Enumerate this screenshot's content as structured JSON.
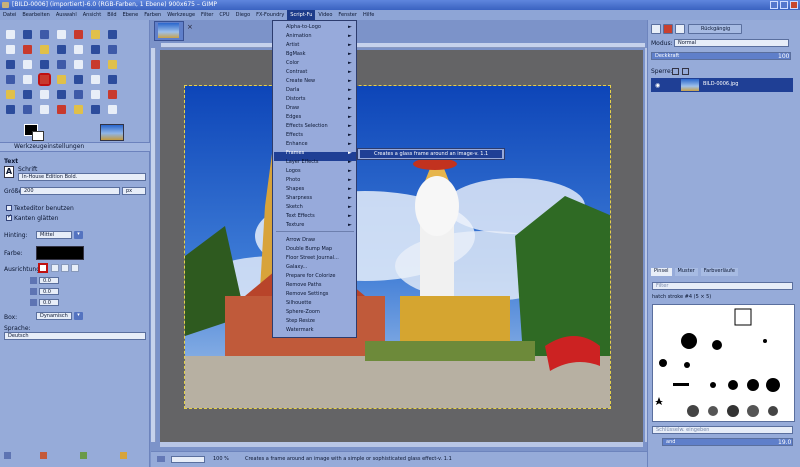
{
  "window": {
    "title": "[BILD-0006] (importiert)-6.0 (RGB-Farben, 1 Ebene) 900x675 – GIMP"
  },
  "menubar": [
    "Datei",
    "Bearbeiten",
    "Auswahl",
    "Ansicht",
    "Bild",
    "Ebene",
    "Farben",
    "Werkzeuge",
    "Filter",
    "CPU",
    "Diego",
    "FX-Foundry",
    "Script-Fu",
    "Video",
    "Fenster",
    "Hilfe"
  ],
  "toolbox": {
    "options_tab": "Werkzeugeinstellungen",
    "tool_name": "Text",
    "font_label": "Schrift",
    "font_value": "In-House Edition Bold.",
    "size_label": "Größe:",
    "size_value": "200",
    "size_unit": "px",
    "use_editor": "Texteditor benutzen",
    "antialias": "Kanten glätten",
    "hinting_label": "Hinting:",
    "hinting_value": "Mittel",
    "color_label": "Farbe:",
    "justify_label": "Ausrichtung",
    "indent_value": "0.0",
    "line_spacing_value": "0.0",
    "letter_spacing_value": "0.0",
    "box_label": "Box:",
    "box_value": "Dynamisch",
    "language_label": "Sprache:",
    "language_value": "Deutsch"
  },
  "scriptfu_menu": {
    "group1": [
      "Alpha-to-Logo",
      "Animation",
      "Artist",
      "BgMask",
      "Color",
      "Contrast",
      "Create New",
      "Darla",
      "Distorts",
      "Draw",
      "Edges",
      "Effects Selection",
      "Effects",
      "Enhance",
      "Frames",
      "Layer Effects",
      "Logos",
      "Photo",
      "Shapes",
      "Sharpness",
      "Sketch",
      "Text Effects",
      "Texture"
    ],
    "group2": [
      "Arrow Draw",
      "Double Bump Map",
      "Floor Street Journal...",
      "Galaxy...",
      "Prepare for Colorize",
      "Remove Paths",
      "Remove Settings",
      "Silhouette",
      "Sphere-Zoom",
      "Step Resize",
      "Watermark"
    ],
    "highlighted": "Frames",
    "submenu_item": "Creates a glass frame around an image-v. 1.1"
  },
  "status": {
    "zoom": "100 %",
    "message": "Creates a frame around an image with a simple or sophisticated glass effect-v. 1.1"
  },
  "layers": {
    "undo_button": "Rückgängig",
    "mode_label": "Modus:",
    "mode_value": "Normal",
    "opacity_label": "Deckkraft",
    "opacity_value": "100",
    "lock_label": "Sperre:",
    "layer_name": "BILD-0006.jpg"
  },
  "brushes": {
    "tabs": [
      "Pinsel",
      "Muster",
      "Farbverläufe"
    ],
    "filter_placeholder": "Filter",
    "current": "hatch stroke #4 (5 × 5)",
    "tag_placeholder": "Schlüsselw. eingeben",
    "brush_field": "and",
    "spacing_value": "19.0"
  }
}
